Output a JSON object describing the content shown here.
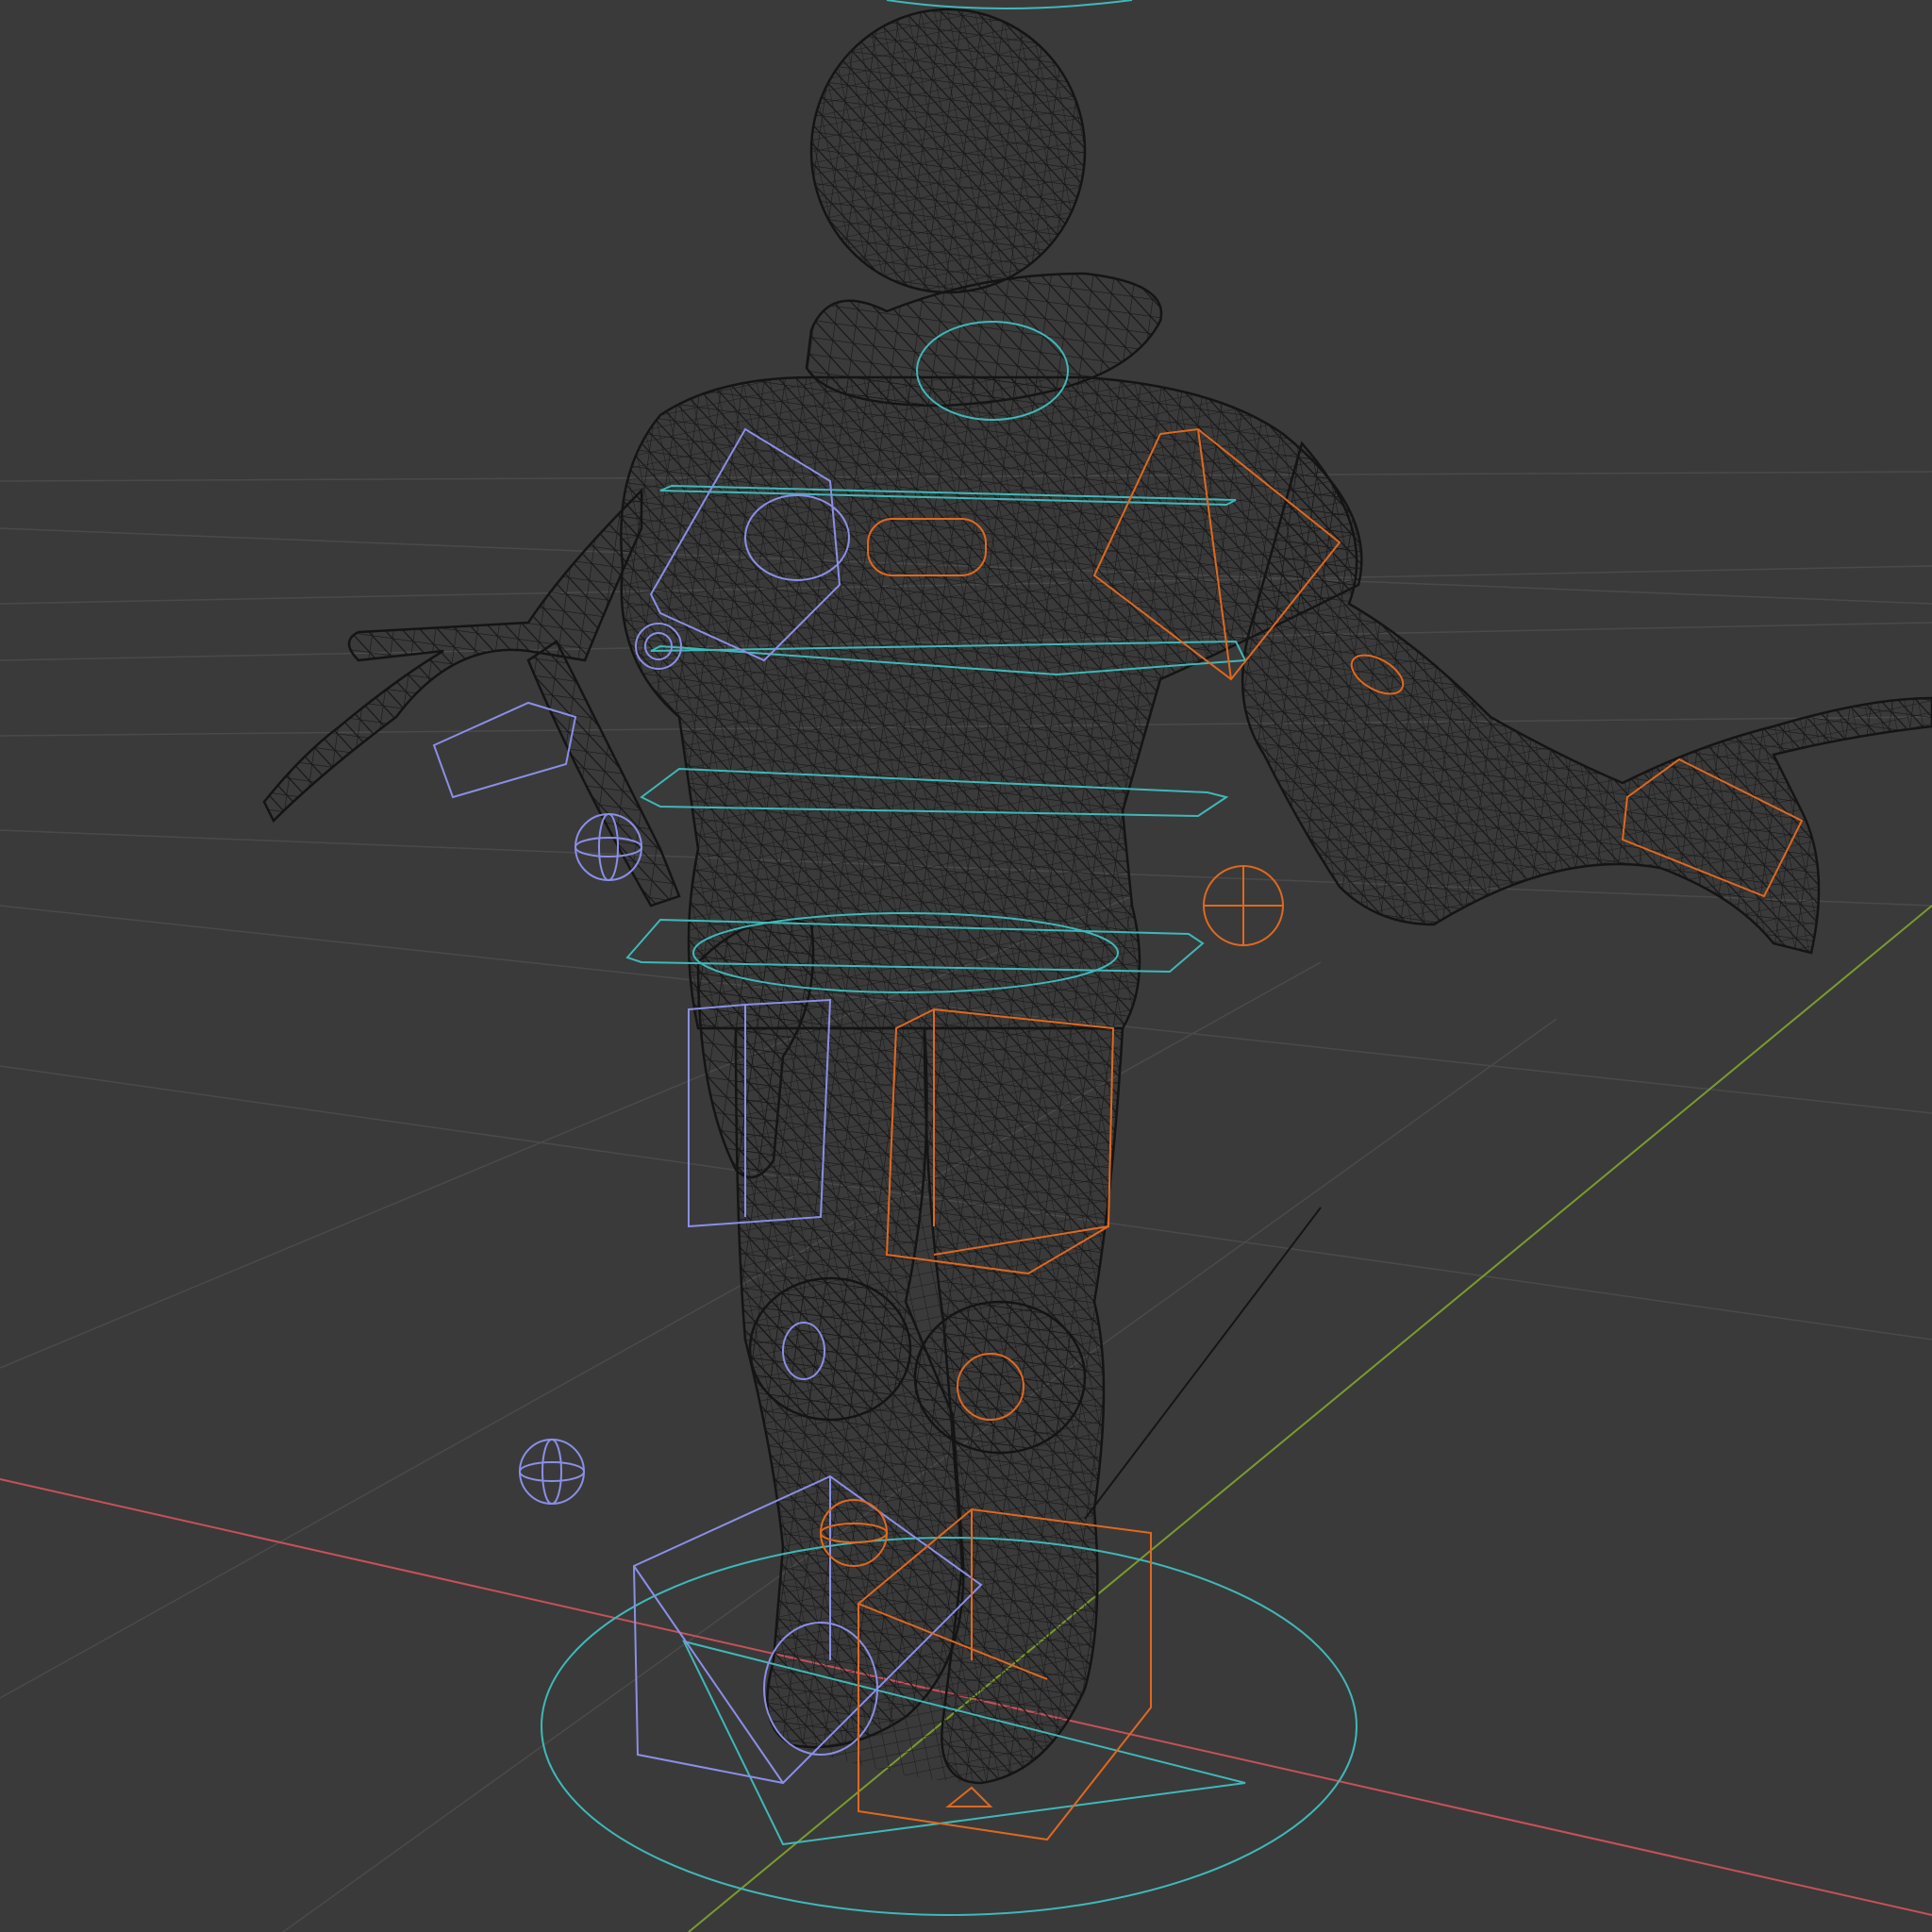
{
  "viewport": {
    "view": "3d-viewport",
    "shading": "wireframe",
    "background_color": "#3a3a3a",
    "grid_color": "#4a4a4a",
    "x_axis_color": "#c8505a",
    "y_axis_color": "#7a9b2e",
    "mesh_color": "#141414",
    "controls": {
      "left_side_color": "#8a8fe6",
      "right_side_color": "#e0681e",
      "center_color": "#3fb8b8"
    }
  }
}
